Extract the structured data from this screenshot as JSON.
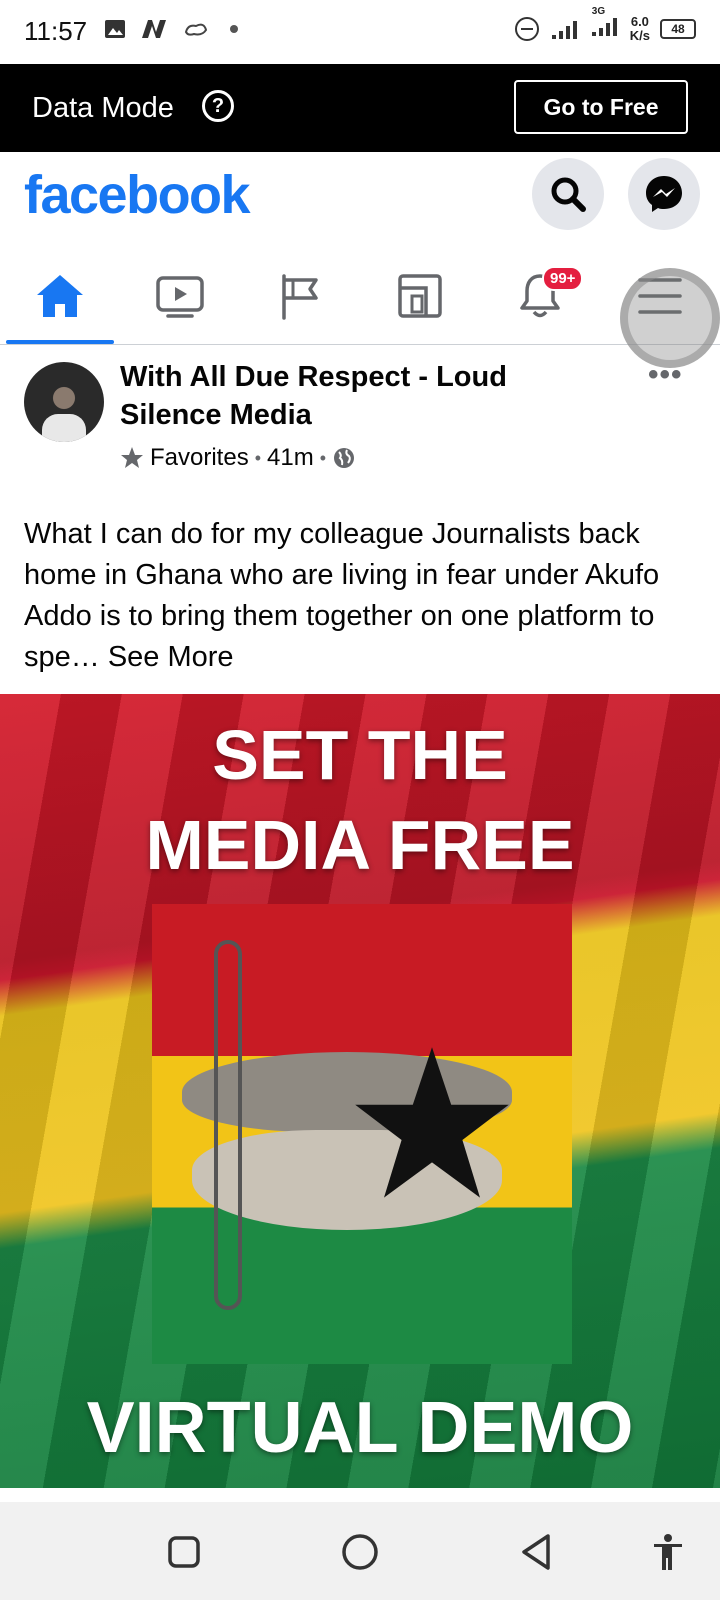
{
  "status_bar": {
    "time": "11:57",
    "network": "3G",
    "speed_value": "6.0",
    "speed_unit": "K/s",
    "battery": "48"
  },
  "data_mode": {
    "label": "Data Mode",
    "help_icon": "?",
    "button_label": "Go to Free"
  },
  "header": {
    "logo": "facebook",
    "icons": [
      "search-icon",
      "messenger-icon"
    ]
  },
  "tabs": [
    {
      "name": "home",
      "icon": "home-icon",
      "active": true
    },
    {
      "name": "watch",
      "icon": "video-icon",
      "active": false
    },
    {
      "name": "pages",
      "icon": "flag-icon",
      "active": false
    },
    {
      "name": "feeds",
      "icon": "feeds-icon",
      "active": false
    },
    {
      "name": "notifications",
      "icon": "bell-icon",
      "badge": "99+",
      "active": false
    },
    {
      "name": "menu",
      "icon": "menu-icon",
      "active": false
    }
  ],
  "post": {
    "author": "With All Due Respect - Loud Silence Media",
    "favorites_label": "Favorites",
    "time": "41m",
    "text": "What I can do for my colleague Journalists back home in Ghana who are living in fear under Akufo Addo is to bring them together on one platform to spe…",
    "see_more": "See More",
    "image": {
      "line1": "SET THE",
      "line2": "MEDIA FREE",
      "line3": "VIRTUAL DEMO"
    }
  },
  "colors": {
    "brand": "#1877f2",
    "badge": "#e41e3f"
  }
}
